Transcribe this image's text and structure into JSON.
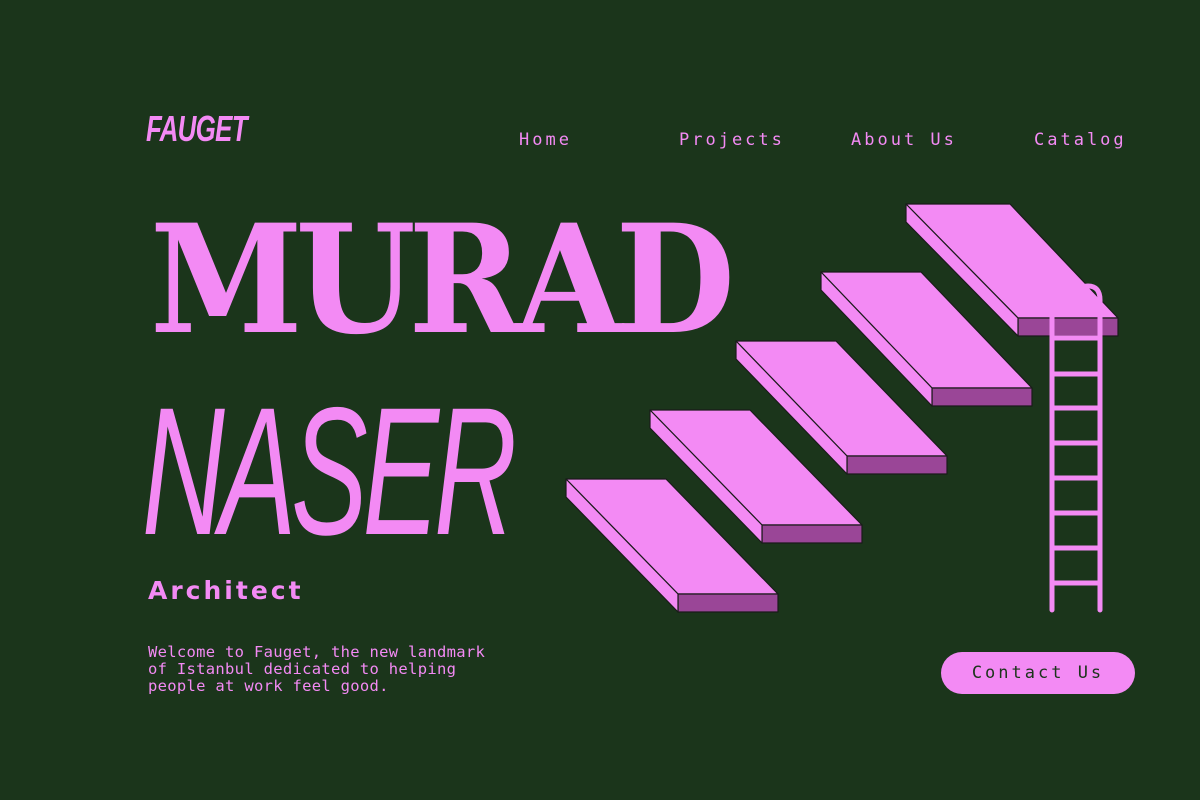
{
  "brand": {
    "logo": "FAUGET"
  },
  "nav": {
    "items": [
      "Home",
      "Projects",
      "About Us",
      "Catalog"
    ]
  },
  "hero": {
    "first_name": "MURAD",
    "last_name": "NASER",
    "role": "Architect",
    "welcome": "Welcome to Fauget, the new landmark of Istanbul dedicated to helping people at work feel good."
  },
  "cta": {
    "label": "Contact Us"
  },
  "colors": {
    "background": "#1b351b",
    "accent": "#f38af4",
    "shadow": "#9a4697"
  },
  "illustration": {
    "icon": "floating-stairs-ladder-illustration"
  }
}
